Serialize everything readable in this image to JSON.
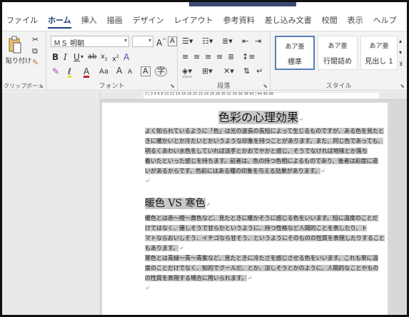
{
  "tabs": [
    "ファイル",
    "ホーム",
    "挿入",
    "描画",
    "デザイン",
    "レイアウト",
    "参考資料",
    "差し込み文書",
    "校閲",
    "表示",
    "ヘルプ"
  ],
  "ribbon": {
    "clipboard": {
      "paste": "貼り付け",
      "label": "クリップボー..."
    },
    "font": {
      "name": "ＭＳ 明朝",
      "size": "",
      "label": "フォント",
      "aa": "Aa",
      "grow": "A",
      "shrink": "A"
    },
    "paragraph": {
      "label": "段落"
    },
    "styles": {
      "label": "スタイル",
      "items": [
        {
          "preview": "あア亜",
          "name": "標準"
        },
        {
          "preview": "あア亜",
          "name": "行間詰め"
        },
        {
          "preview": "あア亜",
          "name": "見出し 1"
        }
      ]
    }
  },
  "ruler": {
    "ticks": "2  |  2  4  6  8  10  12  14  16  18  20  22  24  26  28  30  32  34  36  38  40  |  44  46  48"
  },
  "document": {
    "title": "色彩の心理効果",
    "para1": [
      "よく知られているように「色」は光の波長の長短によって生じるものですが、ある色を見たと",
      "きに暖かいとか冷たいとかいうような印象を持つことがあります。また、同じ色であっても、",
      "明るくあわい水色をしていれば派手とかおでやかと感じ、そうでなければ地味とか落ち",
      "着いたといった感じを持ちます。前者は、色の持つ色相によるものであり、後者は彩度に違",
      "いがあるからです。色彩にはある種の印象を与える効果があります。"
    ],
    "heading2": "暖色 VS 寒色",
    "para2": [
      "暖色とは赤～橙～黄色など、見たときに暖かそうに感じる色をいいます。短に温度のことだ",
      "けではなく、優しそうで甘らかというように、持つ性格など人間的ことを表したり、ト",
      "マトならおいしそう、イチゴなら甘そう、というようにそのものの性質を表現したりすること",
      "もあります。"
    ],
    "para3": [
      "寒色とは青緑～青～青紫など、見たときに冷たさを感じさせる色をいいます。これも単に温",
      "度のことだけでなく、知的でクールだ、とか、涼しそうとかのように、人間的なことやもの",
      "の性質を表現する場合に用いられます。"
    ],
    "para_mark": "↵"
  }
}
